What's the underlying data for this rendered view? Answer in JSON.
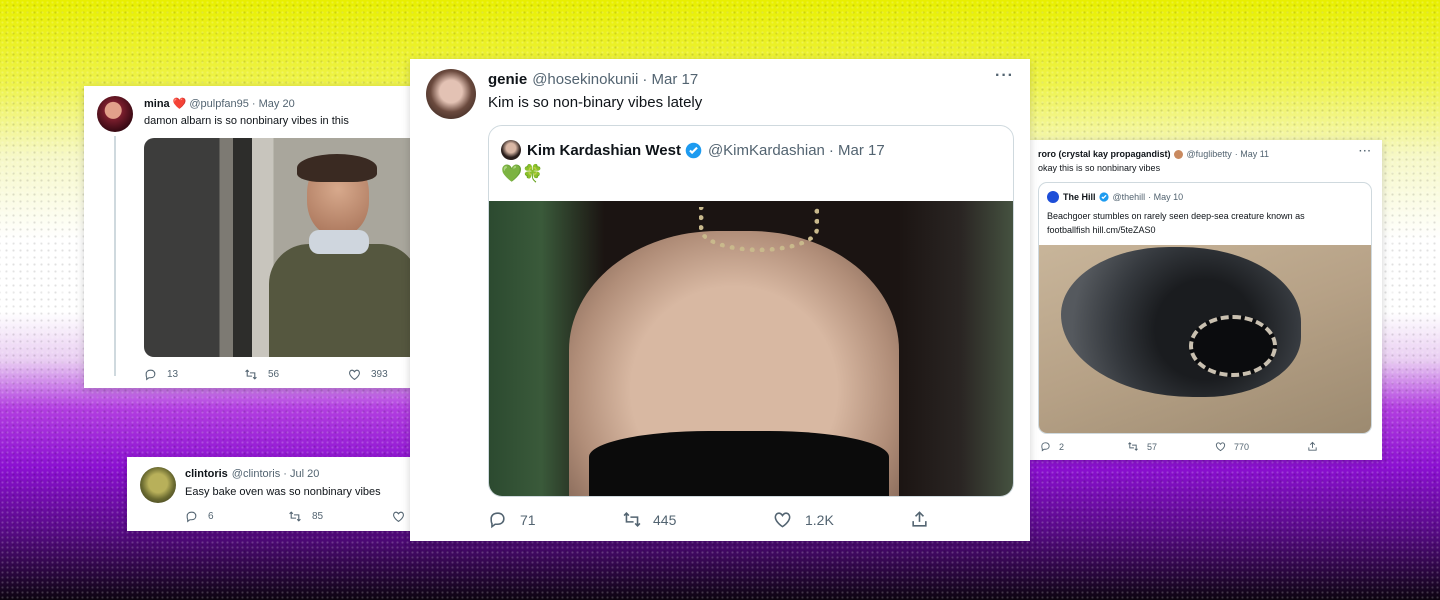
{
  "colors": {
    "accent": "#1d9bf0",
    "heart": "#e0245e",
    "green_heart": "#78b159",
    "background_top": "#e8ef00",
    "background_bottom": "#6b0fb3"
  },
  "tweet_mina": {
    "display_name": "mina",
    "emoji": "❤️",
    "handle": "@pulpfan95",
    "date": "· May 20",
    "text": "damon albarn is so nonbinary vibes in this",
    "replies": "13",
    "retweets": "56",
    "likes": "393"
  },
  "tweet_clintoris": {
    "display_name": "clintoris",
    "handle": "@clintoris",
    "date": "· Jul 20",
    "text": "Easy bake oven was so nonbinary vibes",
    "replies": "6",
    "retweets": "85"
  },
  "tweet_genie": {
    "display_name": "genie",
    "handle": "@hosekinokunii",
    "date": "· Mar 17",
    "text": "Kim is so non-binary vibes lately",
    "more": "···",
    "replies": "71",
    "retweets": "445",
    "likes": "1.2K",
    "quote": {
      "display_name": "Kim Kardashian West",
      "handle": "@KimKardashian",
      "date": "· Mar 17",
      "text": "💚🍀"
    }
  },
  "tweet_roro": {
    "display_name": "roro (crystal kay propagandist)",
    "handle": "@fuglibetty",
    "date": "· May 11",
    "text": "okay this is so nonbinary vibes",
    "more": "···",
    "replies": "2",
    "retweets": "57",
    "likes": "770",
    "quote": {
      "display_name": "The Hill",
      "handle": "@thehill",
      "date": "· May 10",
      "text": "Beachgoer stumbles on rarely seen deep-sea creature known as footballfish hill.cm/5teZAS0"
    }
  }
}
